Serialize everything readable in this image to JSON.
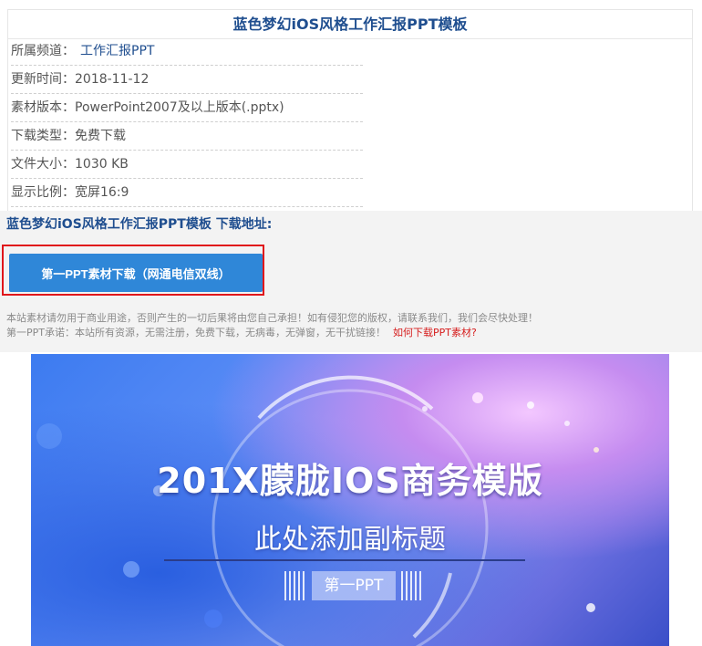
{
  "info": {
    "title": "蓝色梦幻iOS风格工作汇报PPT模板",
    "rows": [
      {
        "label": "所属频道：",
        "value": "工作汇报PPT"
      },
      {
        "label": "更新时间：",
        "value": "2018-11-12"
      },
      {
        "label": "素材版本：",
        "value": "PowerPoint2007及以上版本(.pptx)"
      },
      {
        "label": "下载类型：",
        "value": "免费下载"
      },
      {
        "label": "文件大小：",
        "value": "1030 KB"
      },
      {
        "label": "显示比例：",
        "value": "宽屏16:9"
      }
    ]
  },
  "download": {
    "heading": "蓝色梦幻iOS风格工作汇报PPT模板 下载地址:",
    "button_label": "第一PPT素材下载（网通电信双线）",
    "notice_1": "本站素材请勿用于商业用途，否则产生的一切后果将由您自己承担！如有侵犯您的版权，请联系我们，我们会尽快处理！",
    "notice_2": "第一PPT承诺：本站所有资源，无需注册，免费下载，无病毒，无弹窗，无干扰链接！",
    "help_link": "如何下载PPT素材?"
  },
  "preview": {
    "title": "201X朦胧IOS商务模版",
    "subtitle": "此处添加副标题",
    "badge": "第一PPT"
  },
  "colors": {
    "accent_blue": "#1f4e8f",
    "button_blue": "#2f87d8",
    "highlight_red": "#e0161b",
    "link_red": "#d61c1c"
  }
}
